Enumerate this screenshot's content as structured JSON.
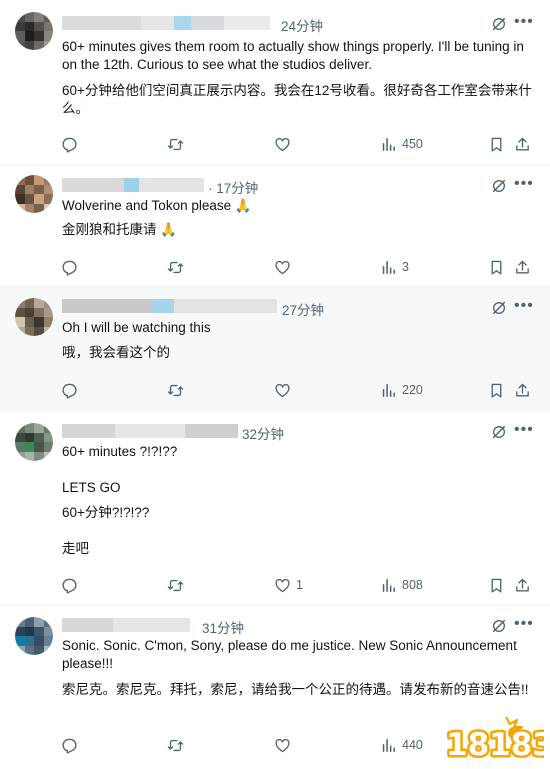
{
  "tweets": [
    {
      "time": "24分钟",
      "lines": [
        "60+ minutes gives them room to actually show things properly. I'll be tuning in on the 12th. Curious to see what the studios deliver.",
        "60+分钟给他们空间真正展示内容。我会在12号收看。很好奇各工作室会带来什么。"
      ],
      "views": "450",
      "likes": ""
    },
    {
      "time": "· 17分钟",
      "lines": [
        "Wolverine and Tokon please 🙏",
        "金刚狼和托康请 🙏"
      ],
      "views": "3",
      "likes": ""
    },
    {
      "time": "27分钟",
      "lines": [
        "Oh I will be watching this",
        "哦，我会看这个的"
      ],
      "views": "220",
      "likes": ""
    },
    {
      "time": "32分钟",
      "lines": [
        "60+ minutes ?!?!??",
        "LETS GO",
        "60+分钟?!?!??",
        "走吧"
      ],
      "views": "808",
      "likes": "1"
    },
    {
      "time": "31分钟",
      "lines": [
        "Sonic. Sonic. C'mon, Sony, please do me justice. New Sonic Announcement please!!!",
        "索尼克。索尼克。拜托，索尼，请给我一个公正的待遇。请发布新的音速公告!!"
      ],
      "views": "440",
      "likes": ""
    }
  ],
  "watermark": "18183",
  "colors": {
    "text": "#0f1419",
    "muted": "#536471",
    "divider": "#eff3f4",
    "highlight": "#f7f9f9",
    "logo": "#f5a700"
  },
  "icons": [
    "reply-icon",
    "retweet-icon",
    "like-icon",
    "views-icon",
    "bookmark-icon",
    "share-icon",
    "grok-icon",
    "more-icon"
  ]
}
